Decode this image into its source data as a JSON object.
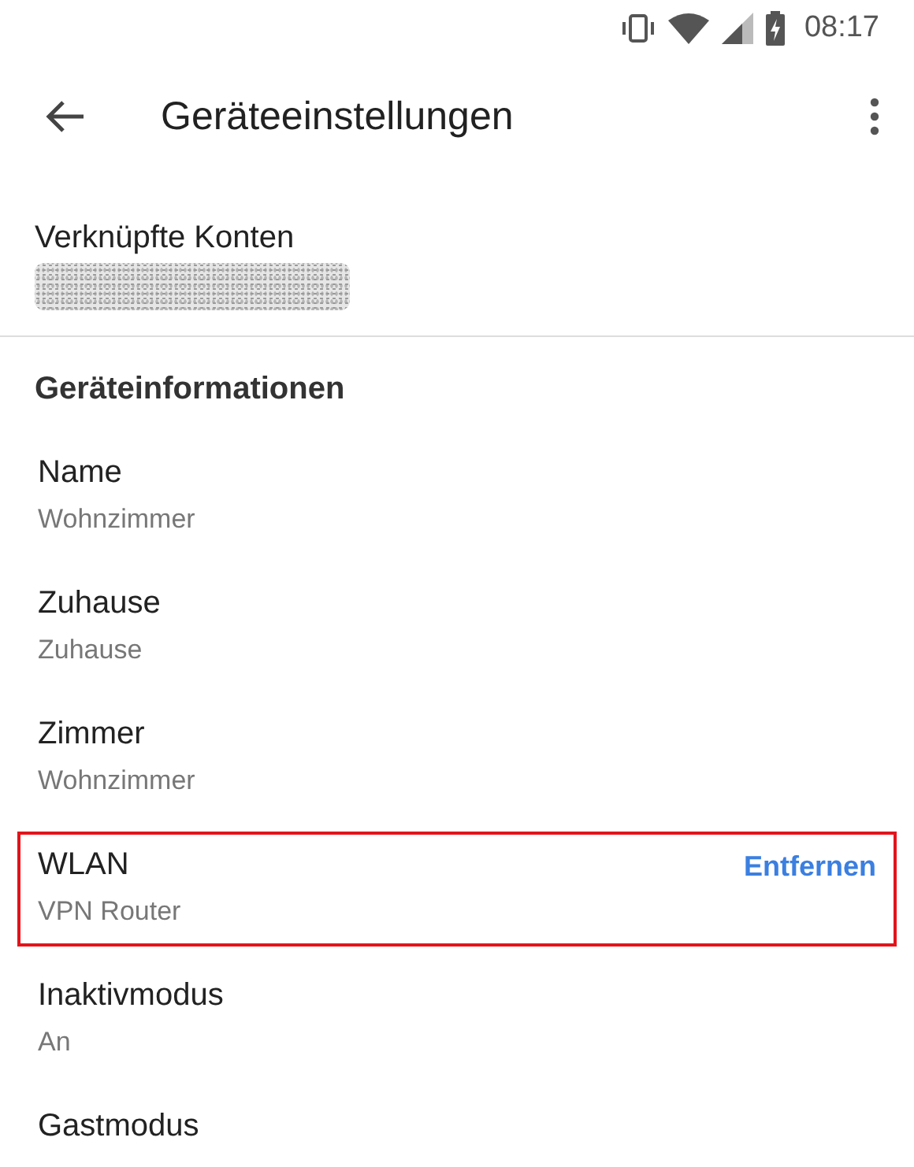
{
  "status_bar": {
    "time": "08:17"
  },
  "toolbar": {
    "title": "Geräteeinstellungen"
  },
  "linked_accounts": {
    "label": "Verknüpfte Konten"
  },
  "section": {
    "title": "Geräteinformationen"
  },
  "rows": [
    {
      "label": "Name",
      "value": "Wohnzimmer",
      "highlighted": false
    },
    {
      "label": "Zuhause",
      "value": "Zuhause",
      "highlighted": false
    },
    {
      "label": "Zimmer",
      "value": "Wohnzimmer",
      "highlighted": false
    },
    {
      "label": "WLAN",
      "value": "VPN Router",
      "action": "Entfernen",
      "highlighted": true
    },
    {
      "label": "Inaktivmodus",
      "value": "An",
      "highlighted": false
    },
    {
      "label": "Gastmodus",
      "highlighted": false
    }
  ]
}
